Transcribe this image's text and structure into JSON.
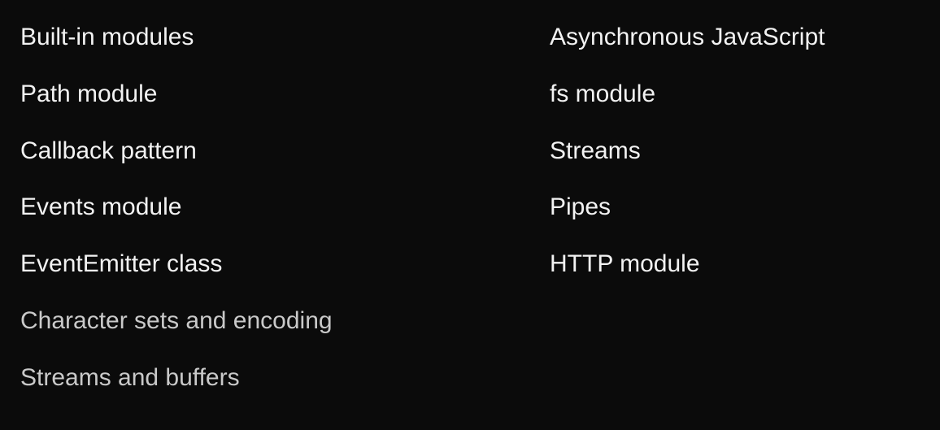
{
  "left_column": {
    "items": [
      {
        "label": "Built-in modules"
      },
      {
        "label": "Path module"
      },
      {
        "label": "Callback pattern"
      },
      {
        "label": "Events module"
      },
      {
        "label": "EventEmitter class"
      },
      {
        "label": "Character sets and encoding"
      },
      {
        "label": "Streams and buffers"
      }
    ]
  },
  "right_column": {
    "items": [
      {
        "label": "Asynchronous JavaScript"
      },
      {
        "label": "fs module"
      },
      {
        "label": "Streams"
      },
      {
        "label": "Pipes"
      },
      {
        "label": "HTTP module"
      }
    ]
  },
  "colors": {
    "background": "#0b0b0b",
    "text": "#f2f2f2",
    "dimmed_text": "#c9c9c9"
  }
}
